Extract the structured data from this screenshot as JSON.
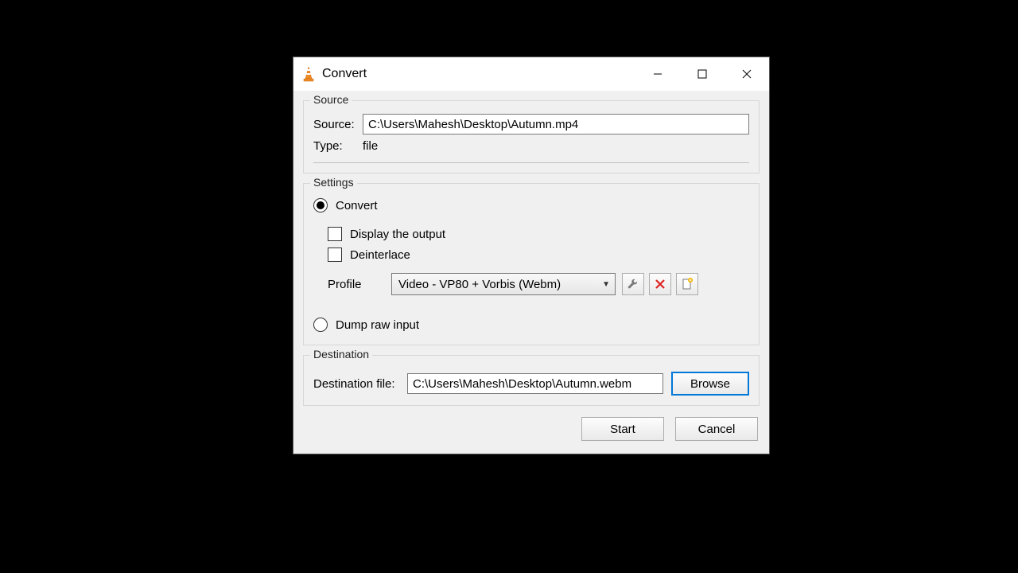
{
  "title": "Convert",
  "source": {
    "legend": "Source",
    "label": "Source:",
    "value": "C:\\Users\\Mahesh\\Desktop\\Autumn.mp4",
    "type_label": "Type:",
    "type_value": "file"
  },
  "settings": {
    "legend": "Settings",
    "convert_label": "Convert",
    "display_output_label": "Display the output",
    "deinterlace_label": "Deinterlace",
    "profile_label": "Profile",
    "profile_value": "Video - VP80 + Vorbis (Webm)",
    "dump_raw_label": "Dump raw input"
  },
  "destination": {
    "legend": "Destination",
    "label": "Destination file:",
    "value": "C:\\Users\\Mahesh\\Desktop\\Autumn.webm",
    "browse": "Browse"
  },
  "footer": {
    "start": "Start",
    "cancel": "Cancel"
  }
}
